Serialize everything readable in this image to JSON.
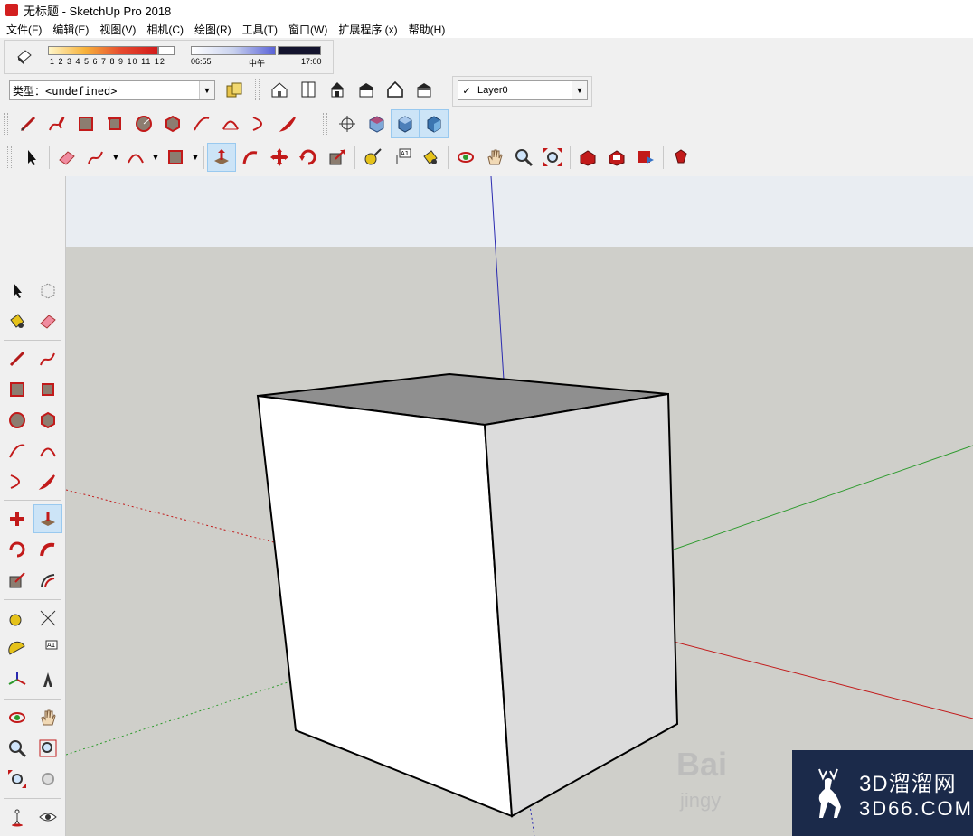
{
  "window": {
    "title": "无标题 - SketchUp Pro 2018"
  },
  "menu": [
    {
      "label": "文件(F)"
    },
    {
      "label": "编辑(E)"
    },
    {
      "label": "视图(V)"
    },
    {
      "label": "相机(C)"
    },
    {
      "label": "绘图(R)"
    },
    {
      "label": "工具(T)"
    },
    {
      "label": "窗口(W)"
    },
    {
      "label": "扩展程序 (x)"
    },
    {
      "label": "帮助(H)"
    }
  ],
  "shadows": {
    "month_ticks": "1 2 3 4 5 6 7 8 9 10 11 12",
    "time_start": "06:55",
    "time_mid": "中午",
    "time_end": "17:00"
  },
  "type_select": {
    "value": "类型：<undefined>"
  },
  "layer_select": {
    "check": "✓",
    "value": "Layer0"
  },
  "colors": {
    "viewport_bg": "#cfcfca",
    "sky": "#e9edf2",
    "red_axis": "#c21a1a",
    "green_axis": "#2c9a2c",
    "blue_axis": "#2a2ab0",
    "accent": "#d32020"
  },
  "watermark": {
    "cn": "3D溜溜网",
    "en": "3D66.COM",
    "baidu": "Bai",
    "baidu_sub": "jingy"
  }
}
